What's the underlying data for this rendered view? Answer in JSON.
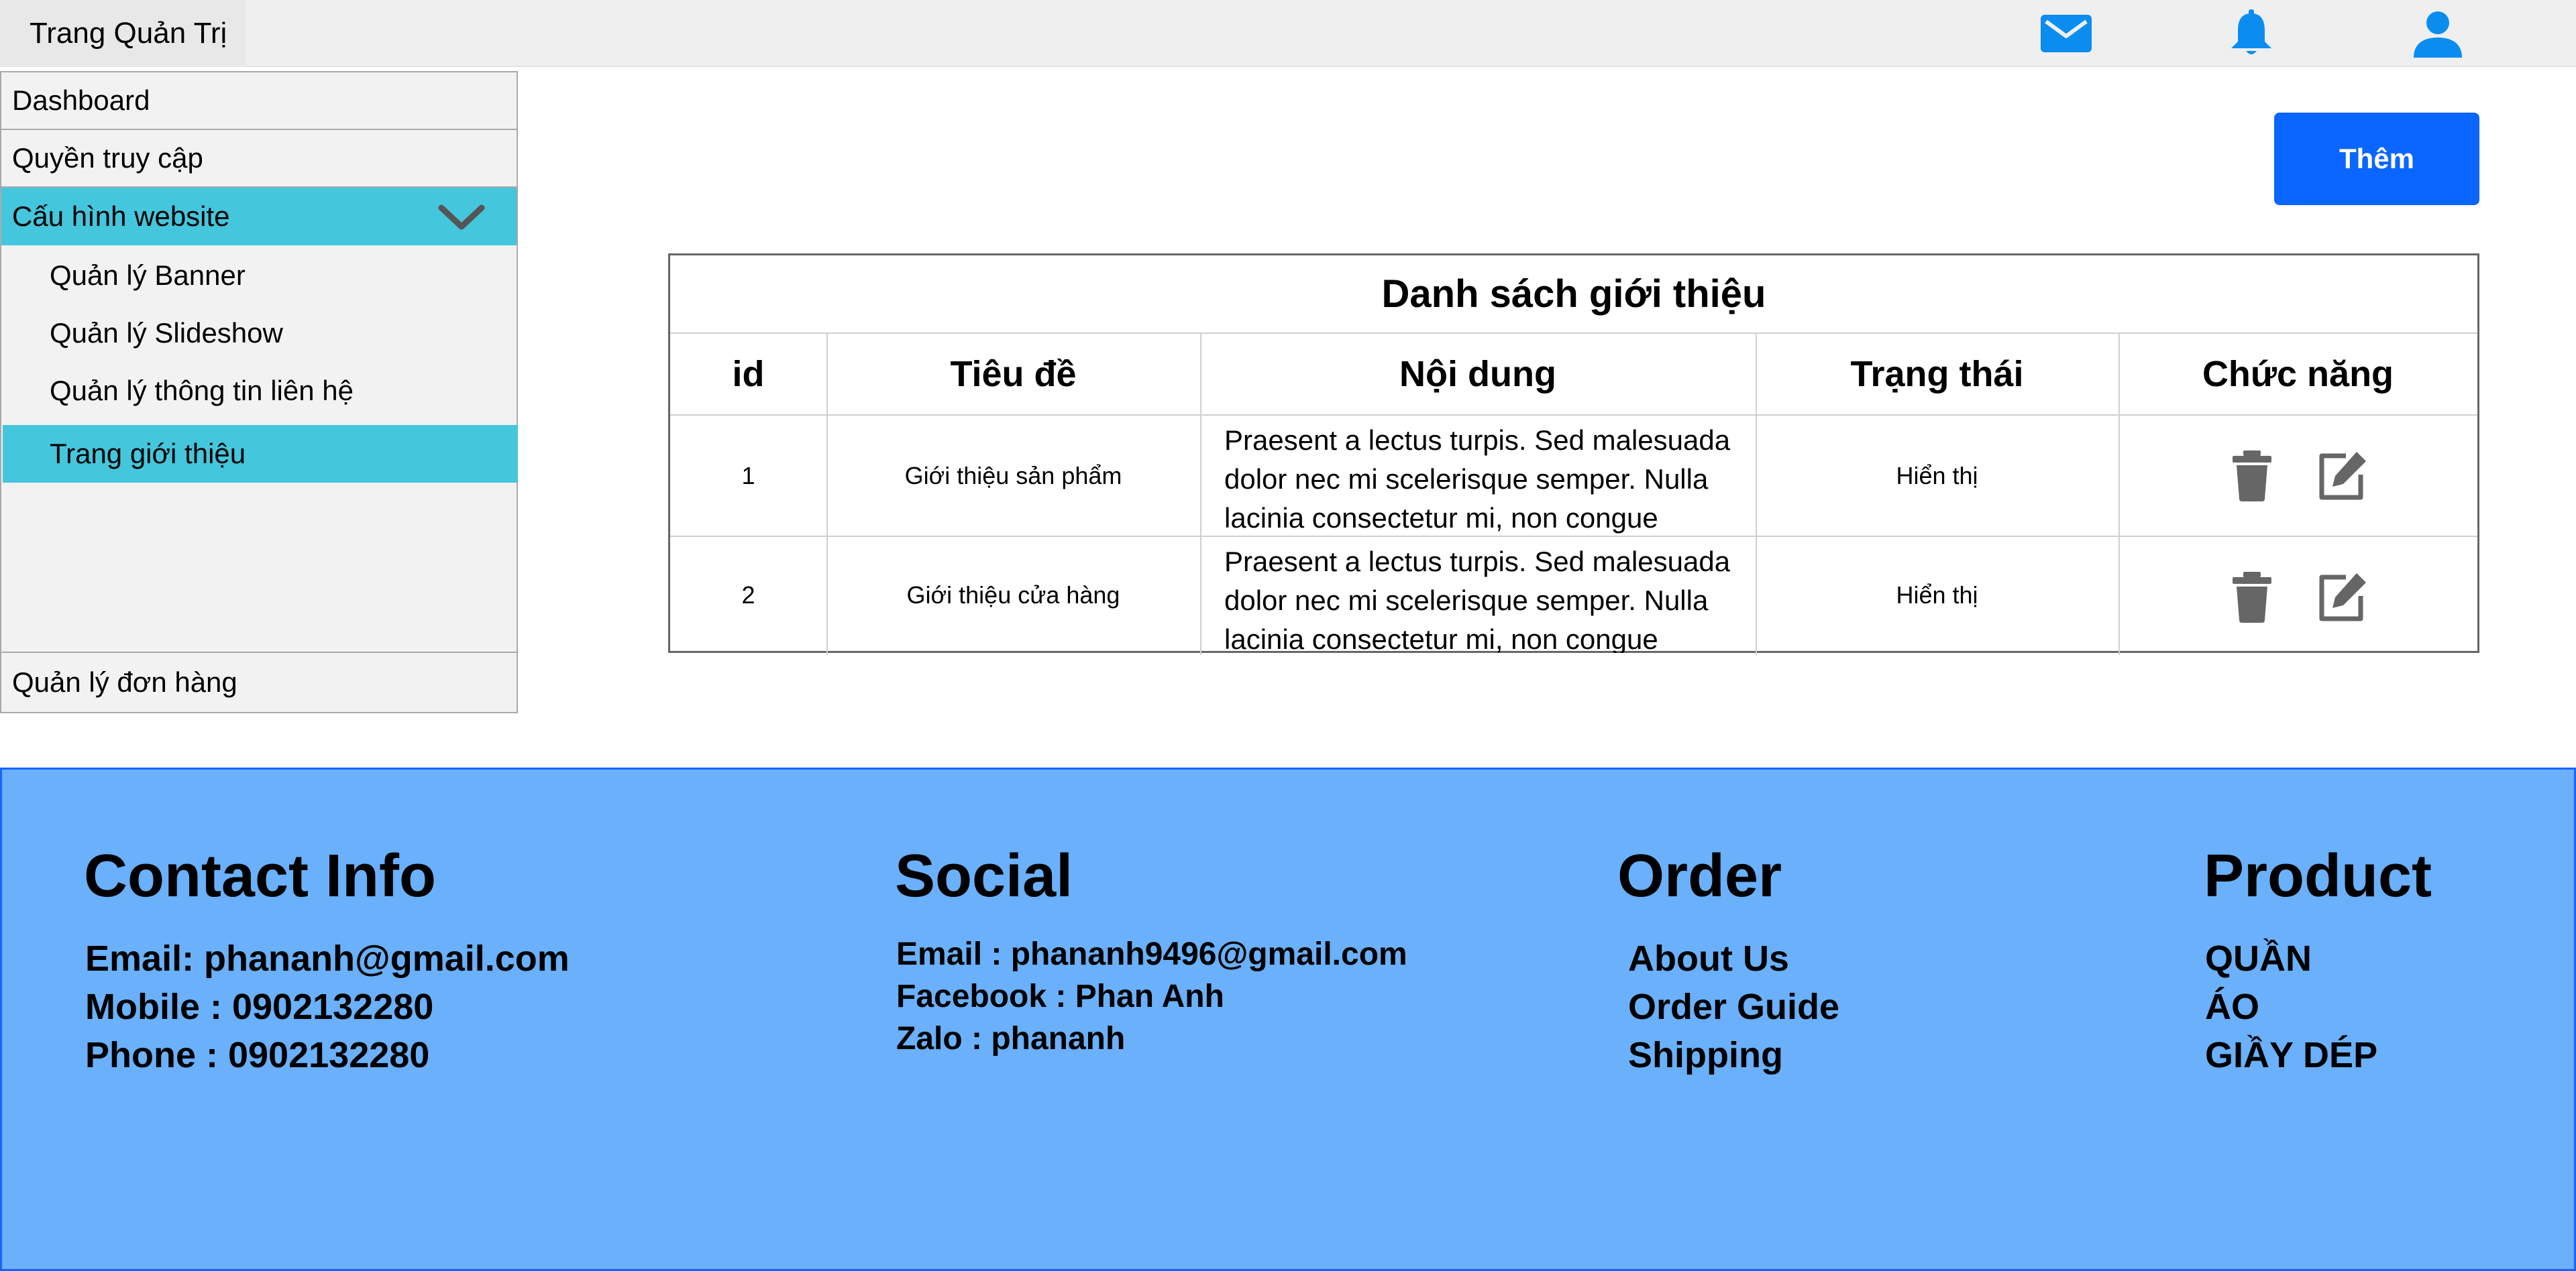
{
  "topbar": {
    "brand": "Trang Quản Trị",
    "icons": [
      "mail-icon",
      "bell-icon",
      "user-icon"
    ]
  },
  "sidebar": {
    "items": [
      {
        "label": "Dashboard"
      },
      {
        "label": "Quyền truy cập"
      },
      {
        "label": "Cấu hình website",
        "expanded": true
      },
      {
        "label": "Quản lý đơn hàng"
      }
    ],
    "subitems": [
      {
        "label": "Quản lý Banner"
      },
      {
        "label": "Quản lý Slideshow"
      },
      {
        "label": "Quản lý thông tin liên hệ"
      },
      {
        "label": "Trang giới thiệu",
        "active": true
      }
    ]
  },
  "main": {
    "add_button": "Thêm",
    "table": {
      "title": "Danh sách giới thiệu",
      "headers": [
        "id",
        "Tiêu đề",
        "Nội dung",
        "Trạng thái",
        "Chức năng"
      ],
      "rows": [
        {
          "id": "1",
          "title": "Giới thiệu sản phẩm",
          "content": "Praesent a lectus turpis. Sed malesuada dolor nec mi scelerisque semper. Nulla lacinia consectetur mi, non congue",
          "status": "Hiển thị"
        },
        {
          "id": "2",
          "title": "Giới thiệu cửa hàng",
          "content": "Praesent a lectus turpis. Sed malesuada dolor nec mi scelerisque semper. Nulla lacinia consectetur mi, non congue",
          "status": "Hiển thị"
        }
      ]
    }
  },
  "footer": {
    "contact": {
      "title": "Contact Info",
      "lines": [
        "Email: phananh@gmail.com",
        "Mobile : 0902132280",
        "Phone : 0902132280"
      ]
    },
    "social": {
      "title": "Social",
      "lines": [
        "Email : phananh9496@gmail.com",
        "Facebook : Phan Anh",
        "Zalo : phananh"
      ]
    },
    "order": {
      "title": "Order",
      "lines": [
        "About Us",
        "Order Guide",
        "Shipping"
      ]
    },
    "product": {
      "title": "Product",
      "lines": [
        "QUẦN",
        "ÁO",
        "GIẦY DÉP"
      ]
    }
  },
  "colors": {
    "accent": "#44c6dc",
    "primary_button": "#0b66ff",
    "top_icons": "#0b8df0",
    "footer_bg": "#6ab0fa",
    "action_icons": "#666666"
  }
}
